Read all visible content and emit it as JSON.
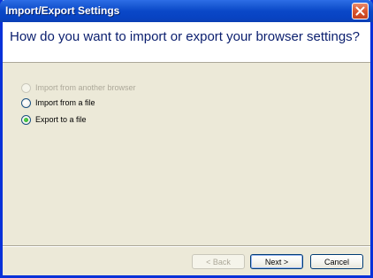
{
  "window": {
    "title": "Import/Export Settings",
    "close_icon": "close-icon"
  },
  "header": {
    "title": "How do you want to import or export your browser settings?"
  },
  "options": [
    {
      "label": "Import from another browser",
      "selected": false,
      "enabled": false
    },
    {
      "label": "Import from a file",
      "selected": false,
      "enabled": true
    },
    {
      "label": "Export to a file",
      "selected": true,
      "enabled": true
    }
  ],
  "buttons": {
    "back": "< Back",
    "next": "Next >",
    "cancel": "Cancel"
  },
  "colors": {
    "title_bar": "#0a48c8",
    "header_text": "#0a1e6e",
    "dialog_bg": "#ece9d8",
    "close_button": "#d9562f"
  }
}
